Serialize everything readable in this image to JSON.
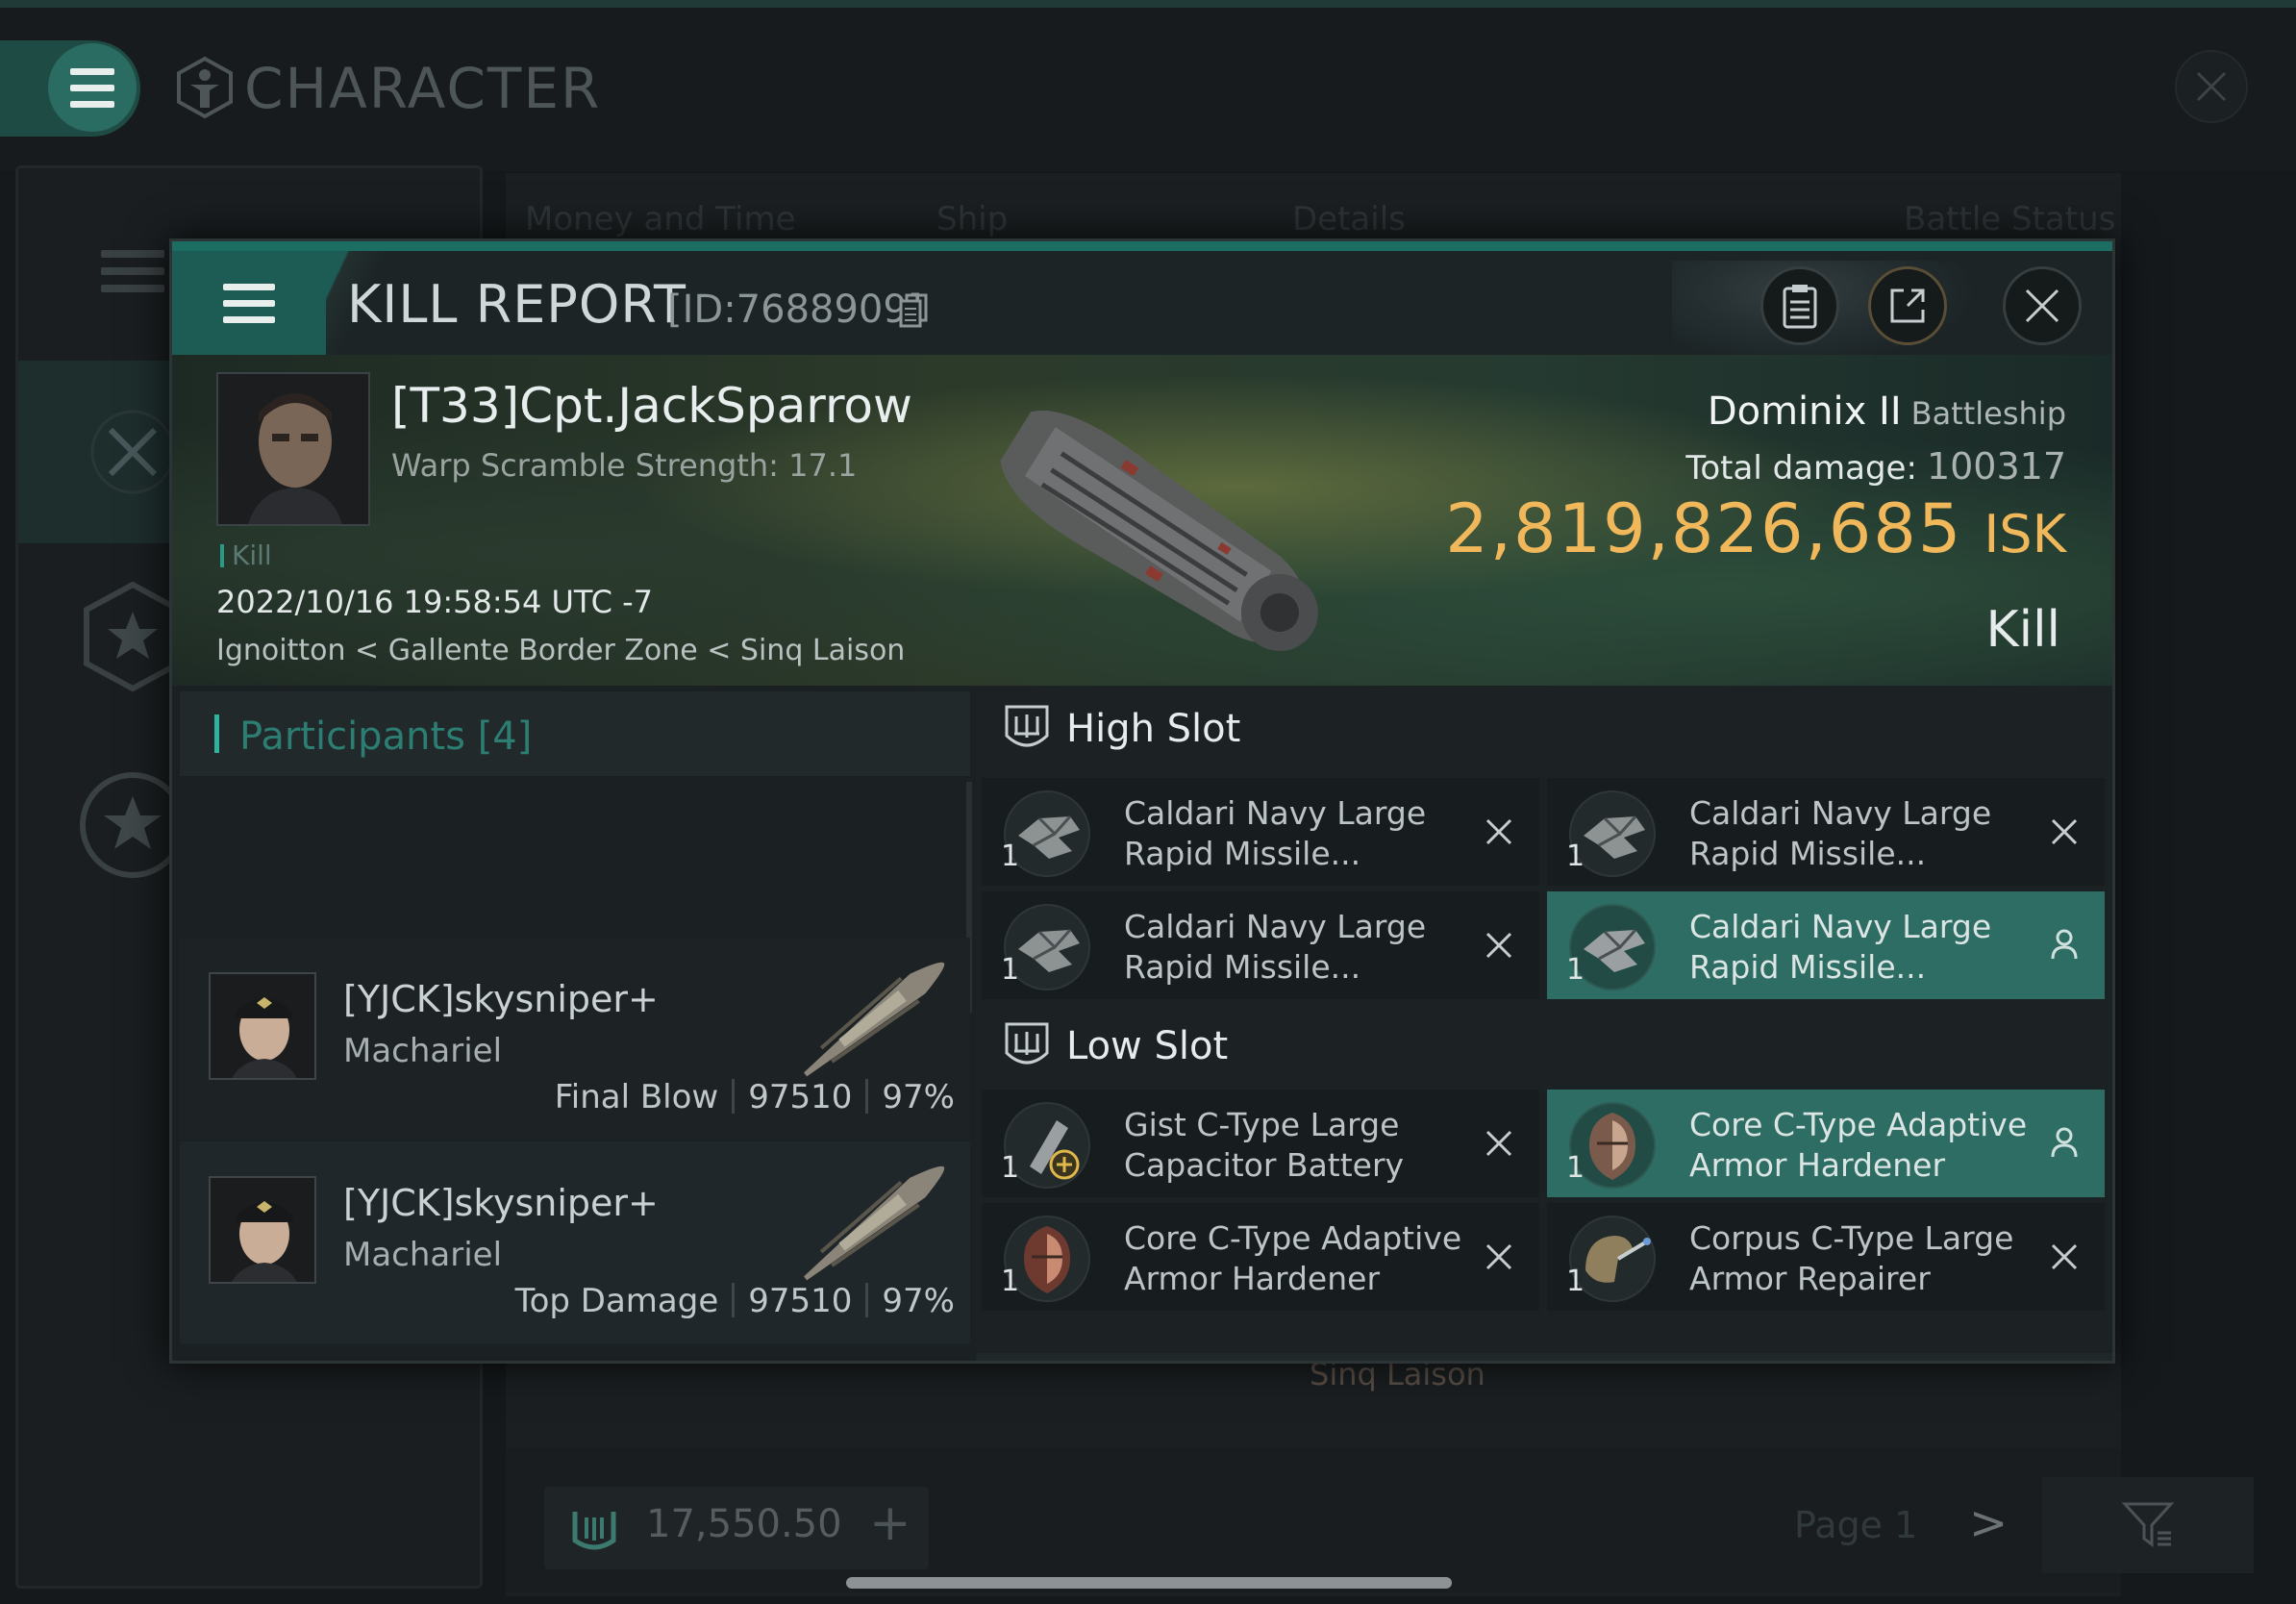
{
  "app": {
    "title": "CHARACTER",
    "columns": [
      "Money and Time",
      "Ship",
      "Details",
      "Battle Status"
    ],
    "bottom_bar": {
      "isk_value": "17,550.50",
      "plus_label": "+",
      "page_label": "Page 1",
      "next_label": ">"
    },
    "background_location": "Sinq Laison"
  },
  "kill_report": {
    "title": "KILL REPORT",
    "id_label": "[ID:7688909]",
    "victim": {
      "name": "[T33]Cpt.JackSparrow",
      "warp_scramble": "Warp Scramble Strength: 17.1",
      "tag": "Kill",
      "datetime": "2022/10/16 19:58:54 UTC -7",
      "location": "Ignoitton < Gallente Border Zone < Sinq Laison"
    },
    "ship": {
      "name": "Dominix II",
      "class": "Battleship",
      "total_damage_label": "Total damage:",
      "total_damage": "100317",
      "isk_value": "2,819,826,685",
      "isk_unit": "ISK",
      "result": "Kill"
    },
    "participants": {
      "title": "Participants",
      "count": "[4]",
      "rows": [
        {
          "name": "[YJCK]skysniper+",
          "ship": "Machariel",
          "role": "Final Blow",
          "damage": "97510",
          "percent": "97%"
        },
        {
          "name": "[YJCK]skysniper+",
          "ship": "Machariel",
          "role": "Top Damage",
          "damage": "97510",
          "percent": "97%"
        }
      ]
    },
    "fitting": {
      "high_slot_title": "High Slot",
      "low_slot_title": "Low Slot",
      "high_slot": [
        {
          "qty": "1",
          "line1": "Caldari Navy Large",
          "line2": "Rapid Missile...",
          "status": "destroyed"
        },
        {
          "qty": "1",
          "line1": "Caldari Navy Large",
          "line2": "Rapid Missile...",
          "status": "destroyed"
        },
        {
          "qty": "1",
          "line1": "Caldari Navy Large",
          "line2": "Rapid Missile...",
          "status": "destroyed"
        },
        {
          "qty": "1",
          "line1": "Caldari Navy Large",
          "line2": "Rapid Missile...",
          "status": "dropped"
        }
      ],
      "low_slot": [
        {
          "qty": "1",
          "line1": "Gist C-Type Large",
          "line2": "Capacitor Battery",
          "status": "destroyed"
        },
        {
          "qty": "1",
          "line1": "Core C-Type Adaptive",
          "line2": "Armor Hardener",
          "status": "dropped"
        },
        {
          "qty": "1",
          "line1": "Core C-Type Adaptive",
          "line2": "Armor Hardener",
          "status": "destroyed"
        },
        {
          "qty": "1",
          "line1": "Corpus C-Type Large",
          "line2": "Armor Repairer",
          "status": "destroyed"
        }
      ]
    }
  },
  "colors": {
    "accent": "#2d6d63",
    "isk": "#f0b85a",
    "teal": "#2fb39c"
  },
  "icons": [
    "menu-icon",
    "character-icon",
    "close-icon",
    "clipboard-icon",
    "share-icon",
    "copy-icon",
    "slot-icon",
    "destroyed-x-icon",
    "dropped-person-icon",
    "filter-icon",
    "star-badge-icon",
    "crossed-swords-icon"
  ]
}
